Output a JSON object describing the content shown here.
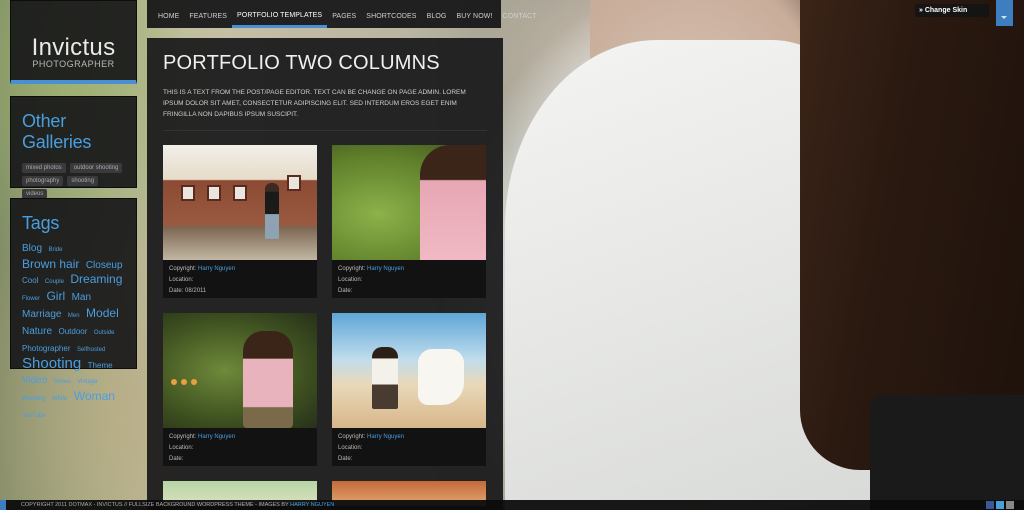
{
  "site": {
    "title": "Invictus",
    "subtitle": "PHOTOGRAPHER"
  },
  "nav": {
    "items": [
      {
        "label": "HOME",
        "active": false
      },
      {
        "label": "FEATURES",
        "active": false
      },
      {
        "label": "PORTFOLIO TEMPLATES",
        "active": true
      },
      {
        "label": "PAGES",
        "active": false
      },
      {
        "label": "SHORTCODES",
        "active": false
      },
      {
        "label": "BLOG",
        "active": false
      },
      {
        "label": "BUY NOW!",
        "active": false
      },
      {
        "label": "CONTACT",
        "active": false
      }
    ]
  },
  "galleries": {
    "heading": "Other Galleries",
    "items": [
      "mixed photos",
      "outdoor shooting",
      "photography",
      "shooting",
      "videos"
    ]
  },
  "tags": {
    "heading": "Tags",
    "items": [
      {
        "label": "Blog",
        "size": "m"
      },
      {
        "label": "Bride",
        "size": "xs"
      },
      {
        "label": "Brown hair",
        "size": "l"
      },
      {
        "label": "Closeup",
        "size": "m"
      },
      {
        "label": "Cool",
        "size": "s"
      },
      {
        "label": "Couple",
        "size": "xs"
      },
      {
        "label": "Dreaming",
        "size": "l"
      },
      {
        "label": "Flower",
        "size": "xs"
      },
      {
        "label": "Girl",
        "size": "l"
      },
      {
        "label": "Man",
        "size": "m"
      },
      {
        "label": "Marriage",
        "size": "m"
      },
      {
        "label": "Men",
        "size": "xs"
      },
      {
        "label": "Model",
        "size": "l"
      },
      {
        "label": "Nature",
        "size": "m"
      },
      {
        "label": "Outdoor",
        "size": "s"
      },
      {
        "label": "Outside",
        "size": "xs"
      },
      {
        "label": "Photographer",
        "size": "s"
      },
      {
        "label": "Selfhosted",
        "size": "xs"
      },
      {
        "label": "Shooting",
        "size": "xl"
      },
      {
        "label": "Theme",
        "size": "s"
      },
      {
        "label": "Video",
        "size": "m"
      },
      {
        "label": "Vimeo",
        "size": "xs"
      },
      {
        "label": "Vintage",
        "size": "xs"
      },
      {
        "label": "Wedding",
        "size": "xs"
      },
      {
        "label": "White",
        "size": "xs"
      },
      {
        "label": "Woman",
        "size": "l"
      },
      {
        "label": "YouTube",
        "size": "xs"
      }
    ]
  },
  "page": {
    "title": "PORTFOLIO TWO COLUMNS",
    "intro": "THIS IS A TEXT FROM THE POST/PAGE EDITOR. TEXT CAN BE CHANGE ON PAGE ADMIN. LOREM IPSUM DOLOR SIT AMET, CONSECTETUR ADIPISCING ELIT. SED INTERDUM EROS EGET ENIM FRINGILLA NON DAPIBUS IPSUM SUSCIPIT."
  },
  "portfolio": {
    "copyright_label": "Copyright:",
    "location_label": "Location:",
    "date_label": "Date:",
    "items": [
      {
        "copyright": "Harry Nguyen",
        "location": "",
        "date": "08/2011"
      },
      {
        "copyright": "Harry Nguyen",
        "location": "",
        "date": ""
      },
      {
        "copyright": "Harry Nguyen",
        "location": "",
        "date": ""
      },
      {
        "copyright": "Harry Nguyen",
        "location": "",
        "date": ""
      }
    ]
  },
  "skin": {
    "label": "» Change Skin"
  },
  "footer": {
    "text": "COPYRIGHT 2011 DOTMAX - INVICTUS // FULLSIZE BACKGROUND WORDPRESS THEME - IMAGES BY",
    "link": "HARRY NGUYEN"
  },
  "colors": {
    "accent": "#4a9ee0",
    "accent_bar": "#4a90d0",
    "panel": "#141416"
  }
}
